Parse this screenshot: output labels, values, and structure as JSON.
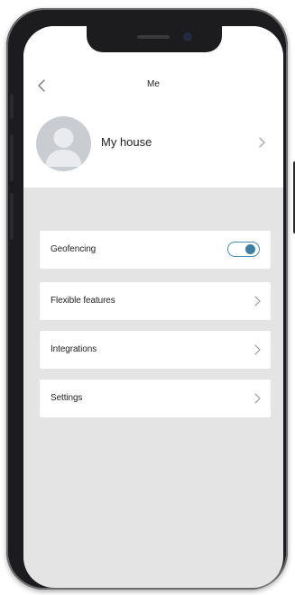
{
  "header": {
    "title": "Me",
    "back_icon": "chevron-left-icon"
  },
  "profile": {
    "name": "My house",
    "avatar_icon": "user-avatar-icon",
    "chevron_icon": "chevron-right-icon"
  },
  "menu": {
    "items": [
      {
        "label": "Geofencing",
        "control": "toggle",
        "toggle_on": true
      },
      {
        "label": "Flexible features",
        "control": "chevron"
      },
      {
        "label": "Integrations",
        "control": "chevron"
      },
      {
        "label": "Settings",
        "control": "chevron"
      }
    ]
  },
  "colors": {
    "toggle_accent": "#3f7ea3",
    "screen_background": "#e4e4e4",
    "card_background": "#ffffff"
  }
}
